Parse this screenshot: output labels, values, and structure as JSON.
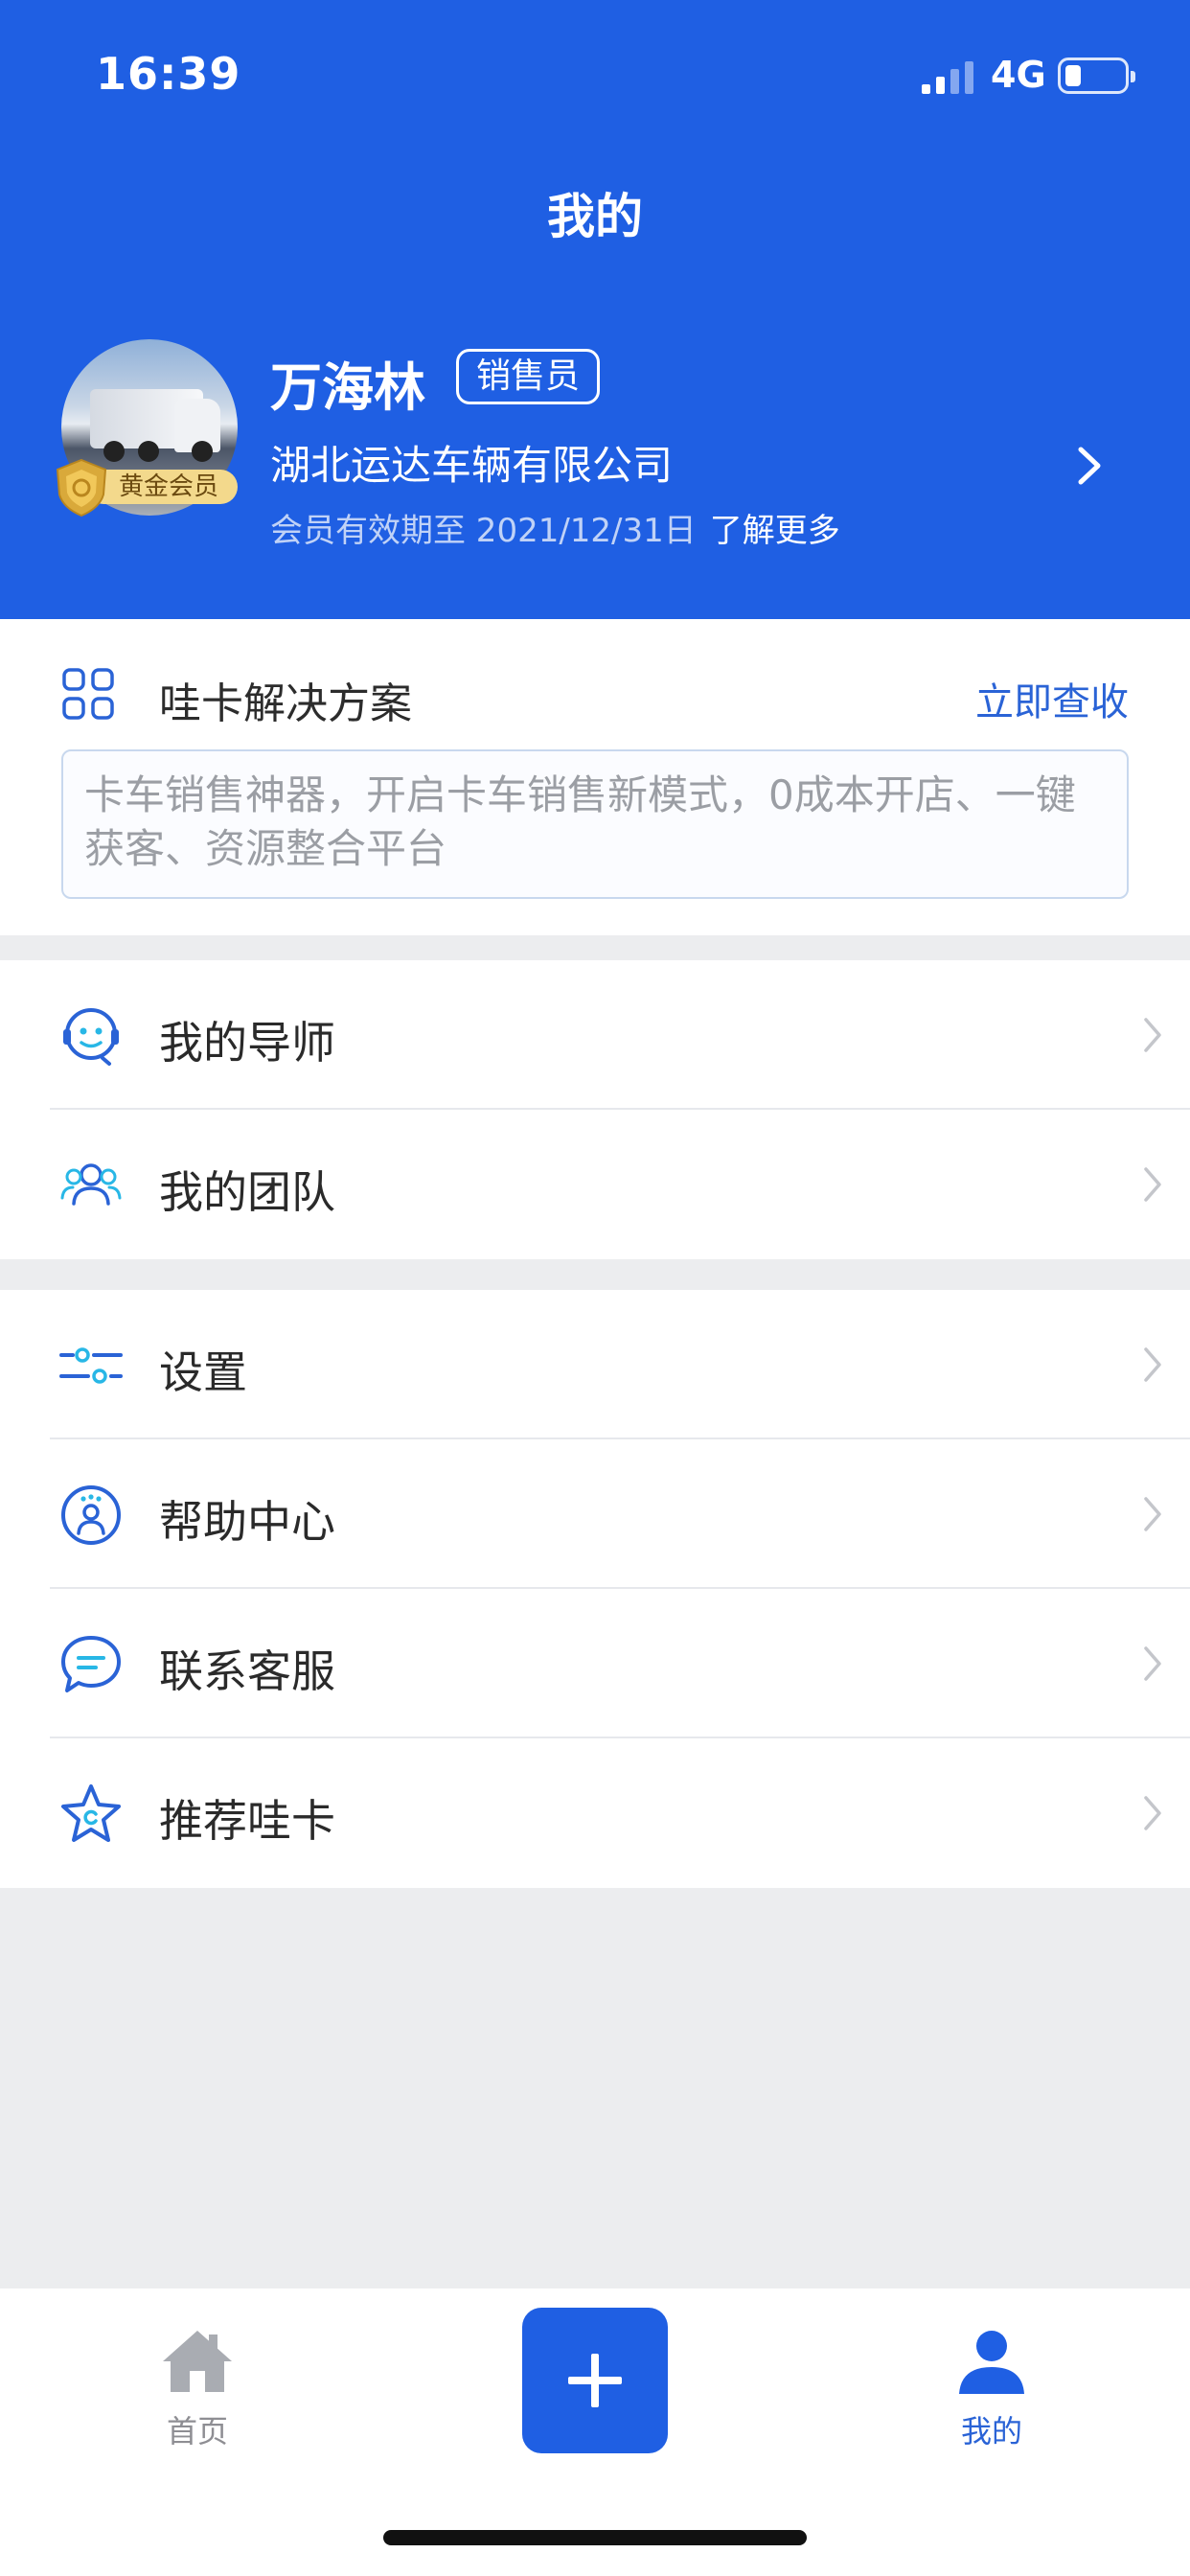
{
  "status_bar": {
    "time": "16:39",
    "network": "4G",
    "battery_level": 0.2
  },
  "header": {
    "title": "我的"
  },
  "profile": {
    "name": "万海林",
    "role": "销售员",
    "company": "湖北运达车辆有限公司",
    "member_level": "黄金会员",
    "expiry_label": "会员有效期至 2021/12/31日",
    "learn_more": "了解更多"
  },
  "solution": {
    "icon": "grid-icon",
    "title": "哇卡解决方案",
    "link": "立即查收",
    "description": "卡车销售神器，开启卡车销售新模式，0成本开店、一键获客、资源整合平台"
  },
  "menu_group_1": [
    {
      "label": "我的导师",
      "icon": "mentor-icon"
    },
    {
      "label": "我的团队",
      "icon": "team-icon"
    }
  ],
  "menu_group_2": [
    {
      "label": "设置",
      "icon": "settings-sliders-icon"
    },
    {
      "label": "帮助中心",
      "icon": "help-icon"
    },
    {
      "label": "联系客服",
      "icon": "chat-bubble-icon"
    },
    {
      "label": "推荐哇卡",
      "icon": "star-icon"
    }
  ],
  "tab_bar": {
    "home": "首页",
    "add": "plus-icon",
    "mine": "我的"
  },
  "colors": {
    "primary": "#1f5fe3",
    "link": "#2a63d6",
    "gold": "#f3d98c",
    "background": "#ecedef"
  }
}
